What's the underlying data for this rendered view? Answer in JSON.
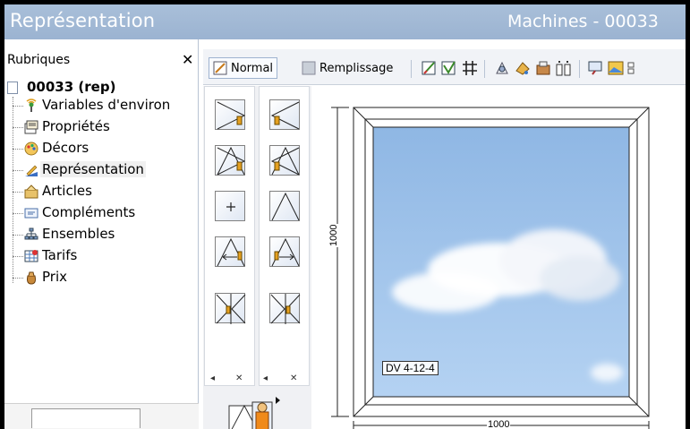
{
  "window": {
    "title": "Représentation",
    "context_title": "Machines - 00033"
  },
  "left_panel": {
    "header": "Rubriques",
    "close_glyph": "✕",
    "root": "00033 (rep)",
    "items": [
      {
        "label": "Variables d'environ",
        "icon": "antenna-icon"
      },
      {
        "label": "Propriétés",
        "icon": "properties-icon"
      },
      {
        "label": "Décors",
        "icon": "palette-icon"
      },
      {
        "label": "Représentation",
        "icon": "drawing-icon",
        "selected": true
      },
      {
        "label": "Articles",
        "icon": "articles-icon"
      },
      {
        "label": "Compléments",
        "icon": "complements-icon"
      },
      {
        "label": "Ensembles",
        "icon": "hierarchy-icon"
      },
      {
        "label": "Tarifs",
        "icon": "tariffs-icon"
      },
      {
        "label": "Prix",
        "icon": "price-bag-icon"
      }
    ]
  },
  "toolbar": {
    "normal_label": "Normal",
    "fill_label": "Remplissage",
    "icons": [
      "edit-profile-icon",
      "edit-check-icon",
      "grid-icon",
      "node-icon",
      "paint-icon",
      "tools-icon",
      "columns-icon",
      "view-icon",
      "image-icon",
      "more-icon"
    ]
  },
  "palette": {
    "nav_left": "◂",
    "nav_down": "✕",
    "items": [
      {
        "icon": "sash-right-opening-icon"
      },
      {
        "icon": "sash-left-opening-icon"
      },
      {
        "icon": "tilt-right-icon"
      },
      {
        "icon": "tilt-left-icon"
      },
      {
        "icon": "fixed-glass-icon"
      },
      {
        "icon": "top-hung-icon"
      },
      {
        "icon": "sliding-left-icon"
      },
      {
        "icon": "sliding-right-icon"
      },
      {
        "icon": "double-sash-icon"
      },
      {
        "icon": "double-sash-alt-icon"
      }
    ]
  },
  "drawing": {
    "height_dim": "1000",
    "width_dim": "1000",
    "glass_label": "DV 4-12-4",
    "sky_color": "#9ec3ea"
  }
}
